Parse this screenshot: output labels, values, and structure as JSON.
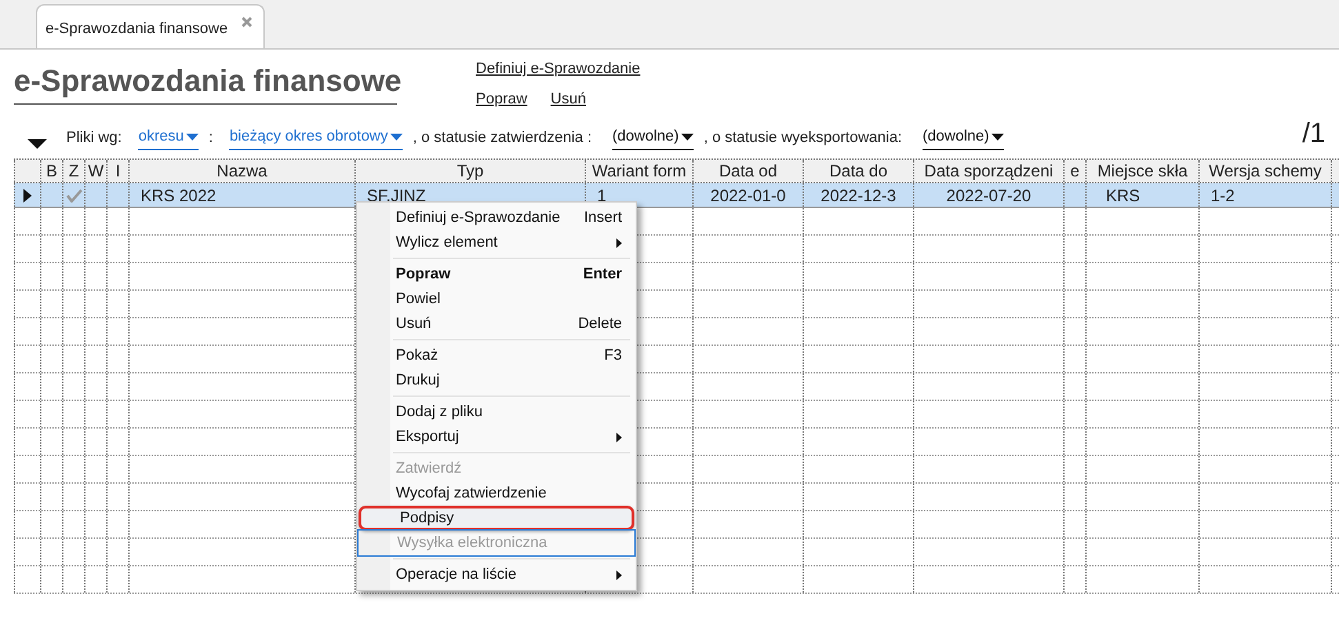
{
  "tabs": [
    {
      "label": "e-Sprawozdania finansowe",
      "selected": true
    }
  ],
  "title": "e-Sprawozdania finansowe",
  "links": [
    "Definiuj e-Sprawozdanie",
    "Popraw",
    "Usuń"
  ],
  "filter": [
    {
      "kind": "label",
      "text": "Pliki wg:"
    },
    {
      "kind": "link",
      "text": "okresu"
    },
    {
      "kind": "label",
      "text": ":"
    },
    {
      "kind": "link",
      "text": "bieżący okres obrotowy"
    },
    {
      "kind": "label",
      "text": ", o statusie zatwierdzenia :"
    },
    {
      "kind": "dropdown",
      "text": "(dowolne)"
    },
    {
      "kind": "label",
      "text": ", o statusie wyeksportowania:"
    },
    {
      "kind": "dropdown",
      "text": "(dowolne)"
    }
  ],
  "page_count": "/1",
  "table": {
    "columns": [
      "B",
      "Z",
      "W",
      "I",
      "Nazwa",
      "Typ",
      "Wariant form",
      "Data od",
      "Data do",
      "Data sporządzeni",
      "e",
      "Miejsce skła",
      "Wersja schemy"
    ],
    "rows": [
      {
        "selected": true,
        "approved": true,
        "cells": [
          "",
          "",
          "",
          "",
          "KRS 2022",
          "SF.JINZ",
          "1",
          "2022-01-0",
          "2022-12-3",
          "2022-07-20",
          "",
          "KRS",
          "1-2"
        ]
      }
    ]
  },
  "context_menu": [
    {
      "kind": "item",
      "label": "Definiuj e-Sprawozdanie",
      "shortcut": "Insert",
      "disabled": false,
      "bold": false,
      "submenu": false,
      "highlighted": false,
      "focused": false
    },
    {
      "kind": "item",
      "label": "Wylicz element",
      "disabled": false,
      "bold": false,
      "submenu": true,
      "highlighted": false,
      "focused": false
    },
    {
      "kind": "separator"
    },
    {
      "kind": "item",
      "label": "Popraw",
      "shortcut": "Enter",
      "disabled": false,
      "bold": true,
      "submenu": false,
      "highlighted": false,
      "focused": false
    },
    {
      "kind": "item",
      "label": "Powiel",
      "disabled": false,
      "bold": false,
      "submenu": false,
      "highlighted": false,
      "focused": false
    },
    {
      "kind": "item",
      "label": "Usuń",
      "shortcut": "Delete",
      "disabled": false,
      "bold": false,
      "submenu": false,
      "highlighted": false,
      "focused": false
    },
    {
      "kind": "separator"
    },
    {
      "kind": "item",
      "label": "Pokaż",
      "shortcut": "F3",
      "disabled": false,
      "bold": false,
      "submenu": false,
      "highlighted": false,
      "focused": false
    },
    {
      "kind": "item",
      "label": "Drukuj",
      "disabled": false,
      "bold": false,
      "submenu": false,
      "highlighted": false,
      "focused": false
    },
    {
      "kind": "separator"
    },
    {
      "kind": "item",
      "label": "Dodaj z pliku",
      "disabled": false,
      "bold": false,
      "submenu": false,
      "highlighted": false,
      "focused": false
    },
    {
      "kind": "item",
      "label": "Eksportuj",
      "disabled": false,
      "bold": false,
      "submenu": true,
      "highlighted": false,
      "focused": false
    },
    {
      "kind": "separator"
    },
    {
      "kind": "item",
      "label": "Zatwierdź",
      "disabled": true,
      "bold": false,
      "submenu": false,
      "highlighted": false,
      "focused": false
    },
    {
      "kind": "item",
      "label": "Wycofaj zatwierdzenie",
      "disabled": false,
      "bold": false,
      "submenu": false,
      "highlighted": false,
      "focused": false
    },
    {
      "kind": "item",
      "label": "Podpisy",
      "disabled": false,
      "bold": false,
      "submenu": false,
      "highlighted": true,
      "focused": false
    },
    {
      "kind": "item",
      "label": "Wysyłka elektroniczna",
      "disabled": true,
      "bold": false,
      "submenu": false,
      "highlighted": false,
      "focused": true
    },
    {
      "kind": "separator"
    },
    {
      "kind": "item",
      "label": "Operacje na liście",
      "disabled": false,
      "bold": false,
      "submenu": true,
      "highlighted": false,
      "focused": false
    }
  ]
}
